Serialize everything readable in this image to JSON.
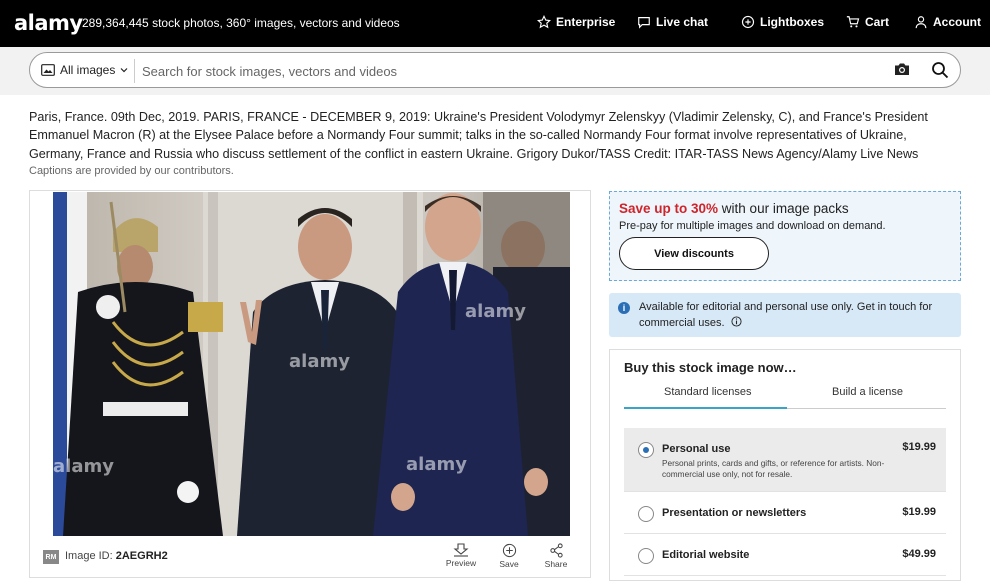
{
  "header": {
    "logo": "alamy",
    "stock_count": "289,364,445 stock photos, 360° images, vectors and videos",
    "nav": [
      {
        "label": "Enterprise",
        "icon": "star-icon"
      },
      {
        "label": "Live chat",
        "icon": "chat-bubble-icon"
      },
      {
        "label": "Lightboxes",
        "icon": "plus-circle-icon"
      },
      {
        "label": "Cart",
        "icon": "cart-icon"
      },
      {
        "label": "Account",
        "icon": "person-icon"
      }
    ]
  },
  "search": {
    "category": "All images",
    "placeholder": "Search for stock images, vectors and videos",
    "value": ""
  },
  "caption": {
    "text": "Paris, France. 09th Dec, 2019. PARIS, FRANCE - DECEMBER 9, 2019: Ukraine's President Volodymyr Zelenskyy (Vladimir Zelensky, C), and France's President Emmanuel Macron (R) at the Elysee Palace before a Normandy Four summit; talks in the so-called Normandy Four format involve representatives of Ukraine, Germany, France and Russia who discuss settlement of the conflict in eastern Ukraine. Grigory Dukor/TASS Credit: ITAR-TASS News Agency/Alamy Live News",
    "note": "Captions are provided by our contributors."
  },
  "image": {
    "watermark": "alamy",
    "rm_badge": "RM",
    "id_label": "Image ID:",
    "id_value": "2AEGRH2",
    "actions": [
      {
        "label": "Preview",
        "icon": "preview-icon"
      },
      {
        "label": "Save",
        "icon": "plus-circle-icon"
      },
      {
        "label": "Share",
        "icon": "share-icon"
      }
    ]
  },
  "promo": {
    "highlight": "Save up to 30%",
    "title_rest": " with our image packs",
    "subtitle": "Pre-pay for multiple images and download on demand.",
    "button": "View discounts"
  },
  "info": {
    "text": "Available for editorial and personal use only. Get in touch for commercial uses."
  },
  "buy": {
    "title": "Buy this stock image now…",
    "tabs": [
      "Standard licenses",
      "Build a license"
    ],
    "options": [
      {
        "name": "Personal use",
        "price": "$19.99",
        "desc": "Personal prints, cards and gifts, or reference for artists. Non-commercial use only, not for resale.",
        "selected": true
      },
      {
        "name": "Presentation or newsletters",
        "price": "$19.99",
        "desc": "",
        "selected": false
      },
      {
        "name": "Editorial website",
        "price": "$49.99",
        "desc": "",
        "selected": false
      }
    ]
  },
  "colors": {
    "topbar": "#000000",
    "promo_highlight": "#d0242b",
    "info_bg": "#d7e8f7",
    "tab_accent": "#3aa3c9",
    "radio_on": "#2a6fb6"
  }
}
